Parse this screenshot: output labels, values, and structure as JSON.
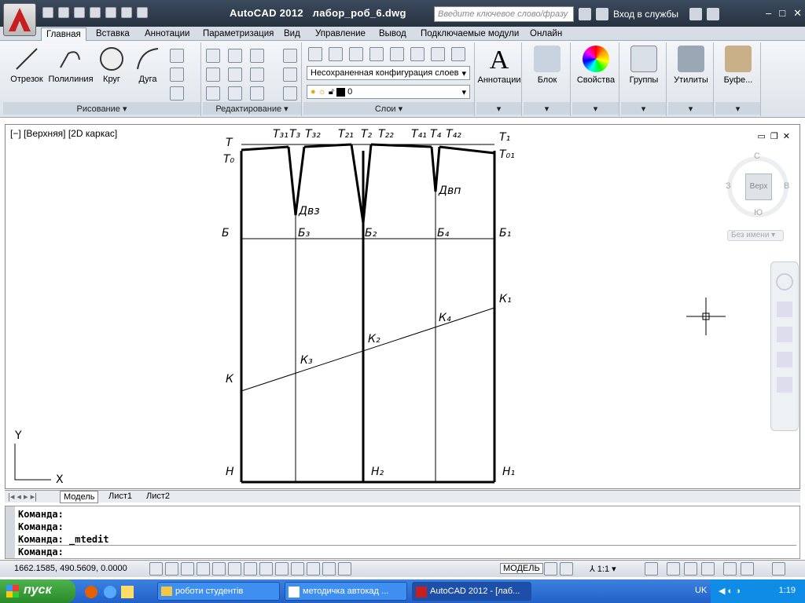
{
  "app": {
    "title": "AutoCAD 2012",
    "filename": "лабор_роб_6.dwg",
    "search_placeholder": "Введите ключевое слово/фразу",
    "login": "Вход в службы"
  },
  "tabs": [
    "Главная",
    "Вставка",
    "Аннотации",
    "Параметризация",
    "Вид",
    "Управление",
    "Вывод",
    "Подключаемые модули",
    "Онлайн"
  ],
  "ribbon": {
    "draw": {
      "title": "Рисование",
      "tools": [
        "Отрезок",
        "Полилиния",
        "Круг",
        "Дуга"
      ]
    },
    "modify": {
      "title": "Редактирование"
    },
    "layers": {
      "title": "Слои",
      "config": "Несохраненная конфигурация слоев",
      "layer": "0"
    },
    "annotations": "Аннотации",
    "block": "Блок",
    "properties": "Свойства",
    "groups": "Группы",
    "utilities": "Утилиты",
    "clipboard": "Буфе..."
  },
  "viewport": {
    "label": "[−] [Верхняя] [2D каркас]"
  },
  "viewcube": {
    "north": "С",
    "south": "Ю",
    "west": "З",
    "east": "В",
    "face": "Верх",
    "ucs": "Без имени"
  },
  "ucs_axes": {
    "x": "X",
    "y": "Y"
  },
  "drawing_labels": {
    "T": "Т",
    "T0": "Т₀",
    "T31": "Т₃₁",
    "T3": "Т₃",
    "T32": "Т₃₂",
    "T21": "Т₂₁",
    "T2": "Т₂",
    "T22": "Т₂₂",
    "T41": "Т₄₁",
    "T4": "Т₄",
    "T42": "Т₄₂",
    "T1": "Т₁",
    "T01": "Т₀₁",
    "Dvz": "Двз",
    "Dvp": "Двп",
    "B": "Б",
    "B3": "Б₃",
    "B2": "Б₂",
    "B4": "Б₄",
    "B1": "Б₁",
    "K": "К",
    "K3": "К₃",
    "K2": "К₂",
    "K4": "К₄",
    "K1": "К₁",
    "H": "Н",
    "H2": "Н₂",
    "H1": "Н₁"
  },
  "layout_tabs": [
    "Модель",
    "Лист1",
    "Лист2"
  ],
  "command": {
    "lines": [
      "Команда:",
      "Команда:",
      "Команда: _mtedit"
    ],
    "prompt": "Команда:"
  },
  "status": {
    "coords": "1662.1585, 490.5609, 0.0000",
    "model": "МОДЕЛЬ",
    "scale": "1:1"
  },
  "taskbar": {
    "start": "пуск",
    "items": [
      "роботи студентів",
      "методичка автокад ...",
      "AutoCAD 2012 - [лаб..."
    ],
    "lang": "UK",
    "time": "1:19"
  }
}
